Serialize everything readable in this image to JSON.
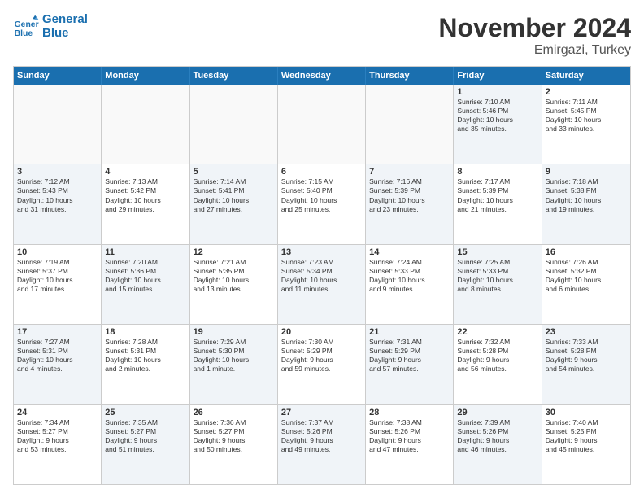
{
  "logo": {
    "line1": "General",
    "line2": "Blue"
  },
  "title": "November 2024",
  "subtitle": "Emirgazi, Turkey",
  "header_days": [
    "Sunday",
    "Monday",
    "Tuesday",
    "Wednesday",
    "Thursday",
    "Friday",
    "Saturday"
  ],
  "rows": [
    [
      {
        "day": "",
        "detail": "",
        "empty": true
      },
      {
        "day": "",
        "detail": "",
        "empty": true
      },
      {
        "day": "",
        "detail": "",
        "empty": true
      },
      {
        "day": "",
        "detail": "",
        "empty": true
      },
      {
        "day": "",
        "detail": "",
        "empty": true
      },
      {
        "day": "1",
        "detail": "Sunrise: 7:10 AM\nSunset: 5:46 PM\nDaylight: 10 hours\nand 35 minutes.",
        "empty": false,
        "shaded": true
      },
      {
        "day": "2",
        "detail": "Sunrise: 7:11 AM\nSunset: 5:45 PM\nDaylight: 10 hours\nand 33 minutes.",
        "empty": false,
        "shaded": false
      }
    ],
    [
      {
        "day": "3",
        "detail": "Sunrise: 7:12 AM\nSunset: 5:43 PM\nDaylight: 10 hours\nand 31 minutes.",
        "empty": false,
        "shaded": true
      },
      {
        "day": "4",
        "detail": "Sunrise: 7:13 AM\nSunset: 5:42 PM\nDaylight: 10 hours\nand 29 minutes.",
        "empty": false,
        "shaded": false
      },
      {
        "day": "5",
        "detail": "Sunrise: 7:14 AM\nSunset: 5:41 PM\nDaylight: 10 hours\nand 27 minutes.",
        "empty": false,
        "shaded": true
      },
      {
        "day": "6",
        "detail": "Sunrise: 7:15 AM\nSunset: 5:40 PM\nDaylight: 10 hours\nand 25 minutes.",
        "empty": false,
        "shaded": false
      },
      {
        "day": "7",
        "detail": "Sunrise: 7:16 AM\nSunset: 5:39 PM\nDaylight: 10 hours\nand 23 minutes.",
        "empty": false,
        "shaded": true
      },
      {
        "day": "8",
        "detail": "Sunrise: 7:17 AM\nSunset: 5:39 PM\nDaylight: 10 hours\nand 21 minutes.",
        "empty": false,
        "shaded": false
      },
      {
        "day": "9",
        "detail": "Sunrise: 7:18 AM\nSunset: 5:38 PM\nDaylight: 10 hours\nand 19 minutes.",
        "empty": false,
        "shaded": true
      }
    ],
    [
      {
        "day": "10",
        "detail": "Sunrise: 7:19 AM\nSunset: 5:37 PM\nDaylight: 10 hours\nand 17 minutes.",
        "empty": false,
        "shaded": false
      },
      {
        "day": "11",
        "detail": "Sunrise: 7:20 AM\nSunset: 5:36 PM\nDaylight: 10 hours\nand 15 minutes.",
        "empty": false,
        "shaded": true
      },
      {
        "day": "12",
        "detail": "Sunrise: 7:21 AM\nSunset: 5:35 PM\nDaylight: 10 hours\nand 13 minutes.",
        "empty": false,
        "shaded": false
      },
      {
        "day": "13",
        "detail": "Sunrise: 7:23 AM\nSunset: 5:34 PM\nDaylight: 10 hours\nand 11 minutes.",
        "empty": false,
        "shaded": true
      },
      {
        "day": "14",
        "detail": "Sunrise: 7:24 AM\nSunset: 5:33 PM\nDaylight: 10 hours\nand 9 minutes.",
        "empty": false,
        "shaded": false
      },
      {
        "day": "15",
        "detail": "Sunrise: 7:25 AM\nSunset: 5:33 PM\nDaylight: 10 hours\nand 8 minutes.",
        "empty": false,
        "shaded": true
      },
      {
        "day": "16",
        "detail": "Sunrise: 7:26 AM\nSunset: 5:32 PM\nDaylight: 10 hours\nand 6 minutes.",
        "empty": false,
        "shaded": false
      }
    ],
    [
      {
        "day": "17",
        "detail": "Sunrise: 7:27 AM\nSunset: 5:31 PM\nDaylight: 10 hours\nand 4 minutes.",
        "empty": false,
        "shaded": true
      },
      {
        "day": "18",
        "detail": "Sunrise: 7:28 AM\nSunset: 5:31 PM\nDaylight: 10 hours\nand 2 minutes.",
        "empty": false,
        "shaded": false
      },
      {
        "day": "19",
        "detail": "Sunrise: 7:29 AM\nSunset: 5:30 PM\nDaylight: 10 hours\nand 1 minute.",
        "empty": false,
        "shaded": true
      },
      {
        "day": "20",
        "detail": "Sunrise: 7:30 AM\nSunset: 5:29 PM\nDaylight: 9 hours\nand 59 minutes.",
        "empty": false,
        "shaded": false
      },
      {
        "day": "21",
        "detail": "Sunrise: 7:31 AM\nSunset: 5:29 PM\nDaylight: 9 hours\nand 57 minutes.",
        "empty": false,
        "shaded": true
      },
      {
        "day": "22",
        "detail": "Sunrise: 7:32 AM\nSunset: 5:28 PM\nDaylight: 9 hours\nand 56 minutes.",
        "empty": false,
        "shaded": false
      },
      {
        "day": "23",
        "detail": "Sunrise: 7:33 AM\nSunset: 5:28 PM\nDaylight: 9 hours\nand 54 minutes.",
        "empty": false,
        "shaded": true
      }
    ],
    [
      {
        "day": "24",
        "detail": "Sunrise: 7:34 AM\nSunset: 5:27 PM\nDaylight: 9 hours\nand 53 minutes.",
        "empty": false,
        "shaded": false
      },
      {
        "day": "25",
        "detail": "Sunrise: 7:35 AM\nSunset: 5:27 PM\nDaylight: 9 hours\nand 51 minutes.",
        "empty": false,
        "shaded": true
      },
      {
        "day": "26",
        "detail": "Sunrise: 7:36 AM\nSunset: 5:27 PM\nDaylight: 9 hours\nand 50 minutes.",
        "empty": false,
        "shaded": false
      },
      {
        "day": "27",
        "detail": "Sunrise: 7:37 AM\nSunset: 5:26 PM\nDaylight: 9 hours\nand 49 minutes.",
        "empty": false,
        "shaded": true
      },
      {
        "day": "28",
        "detail": "Sunrise: 7:38 AM\nSunset: 5:26 PM\nDaylight: 9 hours\nand 47 minutes.",
        "empty": false,
        "shaded": false
      },
      {
        "day": "29",
        "detail": "Sunrise: 7:39 AM\nSunset: 5:26 PM\nDaylight: 9 hours\nand 46 minutes.",
        "empty": false,
        "shaded": true
      },
      {
        "day": "30",
        "detail": "Sunrise: 7:40 AM\nSunset: 5:25 PM\nDaylight: 9 hours\nand 45 minutes.",
        "empty": false,
        "shaded": false
      }
    ]
  ]
}
